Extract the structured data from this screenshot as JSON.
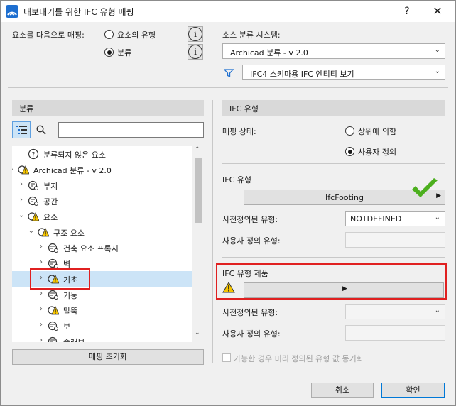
{
  "window": {
    "title": "내보내기를 위한 IFC 유형 매핑",
    "help": "?",
    "close": "✕"
  },
  "mapping": {
    "label": "요소를 다음으로 매핑:",
    "option_type": "요소의 유형",
    "option_classification": "분류",
    "selected": "분류",
    "info": "i"
  },
  "source": {
    "label": "소스 분류 시스템:",
    "value": "Archicad 분류 - v 2.0",
    "filter_value": "IFC4 스키마용 IFC 엔티티 보기"
  },
  "left_panel": {
    "header": "분류",
    "search_value": "",
    "tree": [
      {
        "label": "분류되지 않은 요소",
        "chevron": "",
        "icon": "unclassified"
      },
      {
        "label": "Archicad 분류 - v 2.0",
        "chevron": "⌄",
        "icon": "warn"
      },
      {
        "label": "부지",
        "chevron": "›",
        "icon": "class"
      },
      {
        "label": "공간",
        "chevron": "›",
        "icon": "class"
      },
      {
        "label": "요소",
        "chevron": "⌄",
        "icon": "warn"
      },
      {
        "label": "구조 요소",
        "chevron": "⌄",
        "icon": "warn"
      },
      {
        "label": "건축 요소 프록시",
        "chevron": "›",
        "icon": "class"
      },
      {
        "label": "벽",
        "chevron": "›",
        "icon": "class"
      },
      {
        "label": "기초",
        "chevron": "›",
        "icon": "warn"
      },
      {
        "label": "기둥",
        "chevron": "›",
        "icon": "class"
      },
      {
        "label": "말뚝",
        "chevron": "›",
        "icon": "warn"
      },
      {
        "label": "보",
        "chevron": "›",
        "icon": "class"
      },
      {
        "label": "슬래브",
        "chevron": "›",
        "icon": "class"
      }
    ],
    "selected_index": 8,
    "reset_button": "매핑 초기화"
  },
  "right_panel": {
    "header": "IFC 유형",
    "status_label": "매핑 상태:",
    "status_option_parent": "상위에 의함",
    "status_option_custom": "사용자 정의",
    "status_selected": "사용자 정의",
    "ifc_type_label": "IFC 유형",
    "ifc_type_value": "IfcFooting",
    "predefined_label": "사전정의된 유형:",
    "predefined_value": "NOTDEFINED",
    "user_defined_label": "사용자 정의 유형:",
    "user_defined_value": "",
    "product_label": "IFC 유형 제품",
    "product_value": "",
    "product_predefined_label": "사전정의된 유형:",
    "product_predefined_value": "",
    "product_user_defined_label": "사용자 정의 유형:",
    "product_user_defined_value": "",
    "sync_checkbox_label": "가능한 경우 미리 정의된 유형 값 동기화"
  },
  "footer": {
    "cancel": "취소",
    "ok": "확인"
  },
  "colors": {
    "accent": "#0078d7",
    "highlight": "#e02020",
    "selection": "#cce4f7",
    "check": "#4caf1e",
    "warning": "#f5c400"
  }
}
